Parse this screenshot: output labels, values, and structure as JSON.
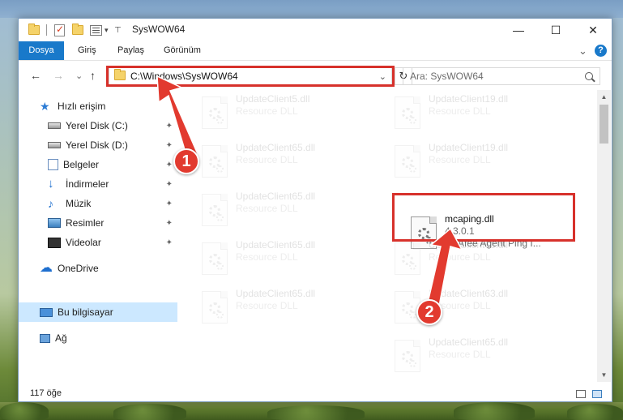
{
  "window": {
    "title": "SysWOW64",
    "minimize_glyph": "—",
    "maximize_glyph": "☐",
    "close_glyph": "✕"
  },
  "ribbon": {
    "tabs": [
      "Dosya",
      "Giriş",
      "Paylaş",
      "Görünüm"
    ],
    "collapse_glyph": "⌄",
    "help_glyph": "?"
  },
  "nav": {
    "back_glyph": "←",
    "forward_glyph": "→",
    "recent_glyph": "⌄",
    "up_glyph": "↑",
    "address": "C:\\Windows\\SysWOW64",
    "address_dropdown_glyph": "⌄",
    "refresh_glyph": "↻",
    "search_placeholder": "Ara: SysWOW64"
  },
  "sidebar": {
    "items": [
      {
        "label": "Hızlı erişim",
        "icon": "star-icon",
        "pinned": false
      },
      {
        "label": "Yerel Disk (C:)",
        "icon": "drive-icon",
        "pinned": true
      },
      {
        "label": "Yerel Disk (D:)",
        "icon": "drive-icon",
        "pinned": true
      },
      {
        "label": "Belgeler",
        "icon": "documents-icon",
        "pinned": true
      },
      {
        "label": "İndirmeler",
        "icon": "download-icon",
        "pinned": true
      },
      {
        "label": "Müzik",
        "icon": "music-icon",
        "pinned": true
      },
      {
        "label": "Resimler",
        "icon": "pictures-icon",
        "pinned": true
      },
      {
        "label": "Videolar",
        "icon": "videos-icon",
        "pinned": true
      },
      {
        "label": "OneDrive",
        "icon": "cloud-icon",
        "pinned": false
      },
      {
        "label": "Bu bilgisayar",
        "icon": "computer-icon",
        "pinned": false,
        "selected": true
      },
      {
        "label": "Ağ",
        "icon": "network-icon",
        "pinned": false
      }
    ],
    "pin_glyph": "📌"
  },
  "files": {
    "faded": [
      {
        "name": "UpdateClient5.dll",
        "type": "Resource DLL"
      },
      {
        "name": "UpdateClient19.dll",
        "type": "Resource DLL"
      },
      {
        "name": "UpdateClient65.dll",
        "type": "Resource DLL"
      },
      {
        "name": "UpdateClient19.dll",
        "type": "Resource DLL"
      },
      {
        "name": "UpdateClient65.dll",
        "type": "Resource DLL"
      },
      {
        "name": "UpdateClient65.dll",
        "type": "Resource DLL"
      },
      {
        "name": "UpdateClient63.dll",
        "type": "Resource DLL"
      },
      {
        "name": "UpdateClient65.dll",
        "type": "Resource DLL"
      },
      {
        "name": "UpdateClient63.dll",
        "type": "Resource DLL"
      },
      {
        "name": "UpdateClient65.dll",
        "type": "Resource DLL"
      }
    ],
    "highlighted": {
      "name": "mcaping.dll",
      "version": "4.3.0.1",
      "description": "McAfee Agent Ping I..."
    }
  },
  "annotations": {
    "step1": "1",
    "step2": "2",
    "arrow_color": "#e23a2f"
  },
  "status": {
    "count": "117 öğe"
  }
}
